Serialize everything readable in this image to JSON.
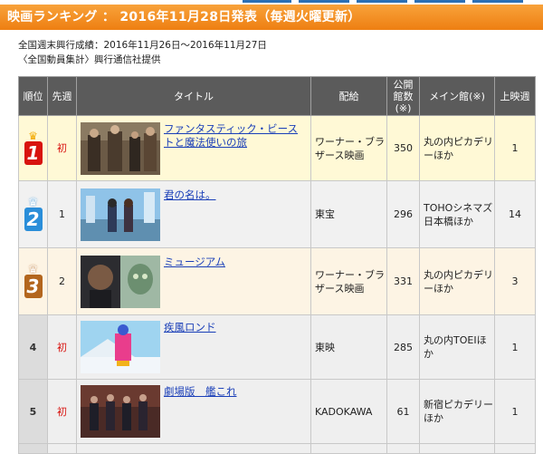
{
  "header": {
    "title": "映画ランキング ： 2016年11月28日発表（毎週火曜更新）"
  },
  "info": {
    "line1": "全国週末興行成績：2016年11月26日～2016年11月27日",
    "line2": "〈全国動員集計〉興行通信社提供"
  },
  "table": {
    "headers": {
      "rank": "順位",
      "prev": "先週",
      "title": "タイトル",
      "distributor": "配給",
      "screens": "公開館数(※)",
      "main_theater": "メイン館(※)",
      "weeks": "上映週"
    },
    "rows": [
      {
        "rank": "1",
        "prev": "初",
        "title": "ファンタスティック・ビーストと魔法使いの旅",
        "distributor": "ワーナー・ブラザース映画",
        "screens": "350",
        "main_theater": "丸の内ピカデリーほか",
        "weeks": "1"
      },
      {
        "rank": "2",
        "prev": "1",
        "title": "君の名は。",
        "distributor": "東宝",
        "screens": "296",
        "main_theater": "TOHOシネマズ日本橋ほか",
        "weeks": "14"
      },
      {
        "rank": "3",
        "prev": "2",
        "title": "ミュージアム",
        "distributor": "ワーナー・ブラザース映画",
        "screens": "331",
        "main_theater": "丸の内ピカデリーほか",
        "weeks": "3"
      },
      {
        "rank": "4",
        "prev": "初",
        "title": "疾風ロンド",
        "distributor": "東映",
        "screens": "285",
        "main_theater": "丸の内TOEIほか",
        "weeks": "1"
      },
      {
        "rank": "5",
        "prev": "初",
        "title": "劇場版　艦これ",
        "distributor": "KADOKAWA",
        "screens": "61",
        "main_theater": "新宿ピカデリーほか",
        "weeks": "1"
      }
    ]
  },
  "colors": {
    "header_orange": "#ee7f12",
    "gold_badge": "#d8130f",
    "silver_badge": "#2a8ed9",
    "bronze_badge": "#b3661e",
    "link_blue": "#1a3fb8",
    "new_red": "#d8130f"
  },
  "icons": {
    "crown": "crown-icon"
  }
}
